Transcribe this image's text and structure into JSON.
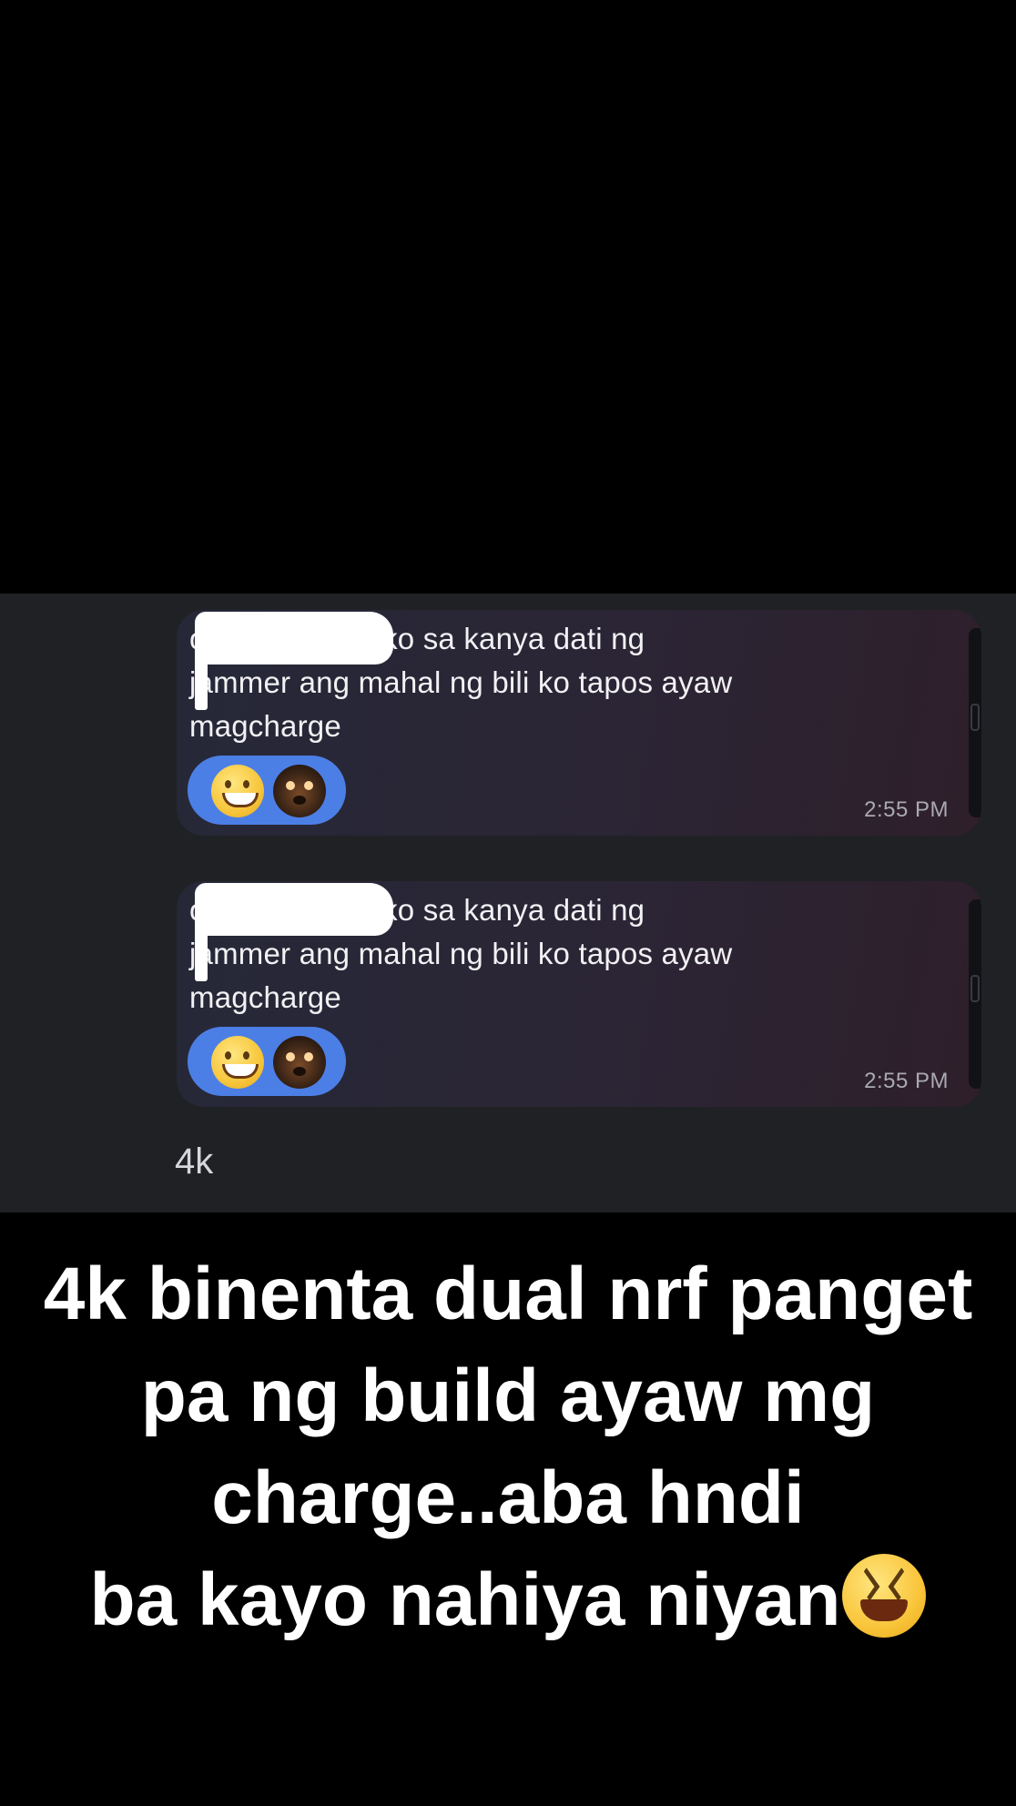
{
  "messages": [
    {
      "text": "o,bumili kasi ako sa kanya dati ng\njammer ang mahal ng bili ko tapos ayaw\nmagcharge",
      "time": "2:55 PM",
      "reactions": [
        "grinning-face-icon",
        "bear-sticker-icon"
      ]
    },
    {
      "text": "o,bumili kasi ako sa kanya dati ng\njammer ang mahal ng bili ko tapos ayaw\nmagcharge",
      "time": "2:55 PM",
      "reactions": [
        "grinning-face-icon",
        "bear-sticker-icon"
      ]
    }
  ],
  "chat_footer_text": "4k",
  "caption": {
    "lines": [
      "4k binenta dual nrf panget",
      "pa ng build ayaw mg",
      "charge..aba hndi",
      "ba kayo nahiya niyan"
    ],
    "trailing_emoji": "laughing-squinting-face-icon"
  },
  "colors": {
    "background": "#000000",
    "chat_panel": "#202124",
    "bubble": "#2a2636",
    "reaction_pill": "#4c7fe6",
    "timestamp": "#a9a9b3",
    "text": "#ffffff"
  }
}
